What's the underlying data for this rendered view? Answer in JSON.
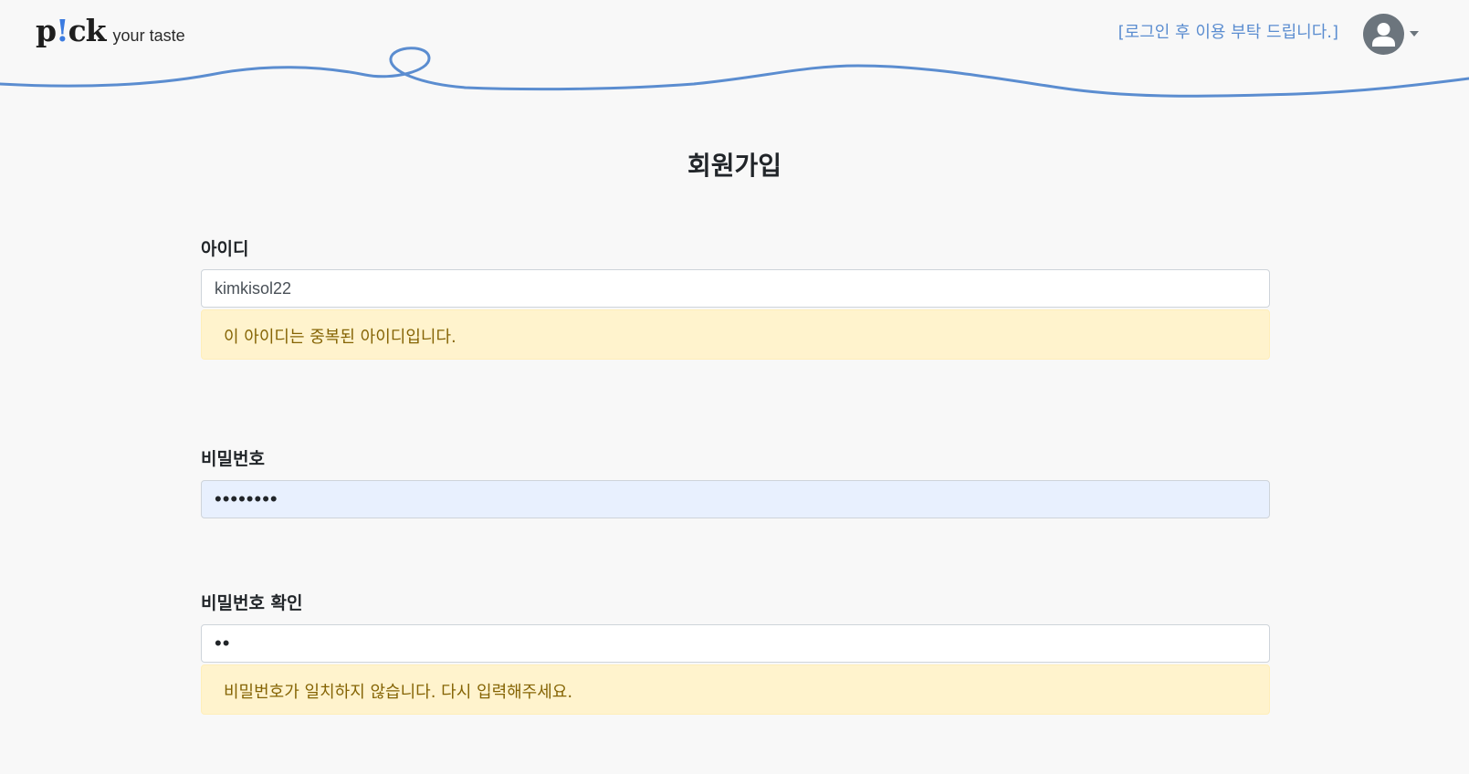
{
  "header": {
    "logo_mark_p": "p",
    "logo_mark_bang": "!",
    "logo_mark_ck": "ck",
    "logo_tagline": "your taste",
    "login_notice": "[로그인 후 이용 부탁 드립니다.]",
    "user_icon": "user-circle-icon",
    "dropdown_icon": "caret-down-icon",
    "wave_color": "#5b8dd0"
  },
  "page": {
    "title": "회원가입"
  },
  "form": {
    "id": {
      "label": "아이디",
      "value": "kimkisol22",
      "alert": "이 아이디는 중복된 아이디입니다."
    },
    "password": {
      "label": "비밀번호",
      "value": "••••••••"
    },
    "password_confirm": {
      "label": "비밀번호 확인",
      "value": "••",
      "alert": "비밀번호가 일치하지 않습니다. 다시 입력해주세요."
    }
  },
  "colors": {
    "background": "#f8f8f8",
    "alert_bg": "#fff3cd",
    "alert_text": "#856404",
    "autofill_bg": "#e8f0fe",
    "link": "#5b8dd0"
  }
}
